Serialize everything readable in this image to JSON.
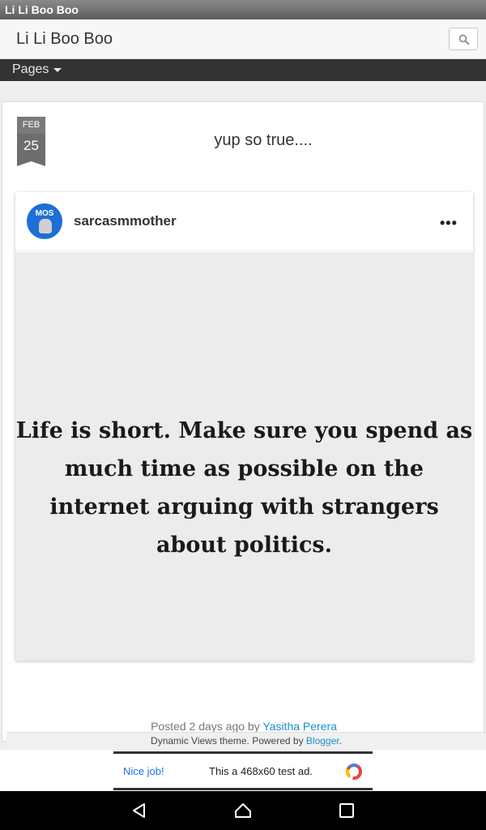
{
  "browser": {
    "tab_title": "Li Li Boo Boo"
  },
  "header": {
    "title": "Li Li Boo Boo",
    "search_icon": "search-icon"
  },
  "nav": {
    "pages_label": "Pages"
  },
  "post": {
    "date_month": "FEB",
    "date_day": "25",
    "title": "yup so true....",
    "embed": {
      "avatar_text": "MOS",
      "username": "sarcasmmother",
      "more_icon": "•••",
      "quote": "Life is short. Make sure you spend as much time as possible on the internet arguing with strangers about politics."
    },
    "posted": {
      "prefix": "Posted ",
      "age": "2 days ago",
      "by": " by ",
      "author": "Yasitha Perera"
    }
  },
  "footer": {
    "text": "Dynamic Views theme. Powered by ",
    "link": "Blogger",
    "suffix": "."
  },
  "ad": {
    "nice_job": "Nice job!",
    "message": "This a 468x60 test ad."
  },
  "colors": {
    "link": "#1a90c8",
    "nav_bar": "#333333",
    "ad_blue": "#1a73e8"
  }
}
